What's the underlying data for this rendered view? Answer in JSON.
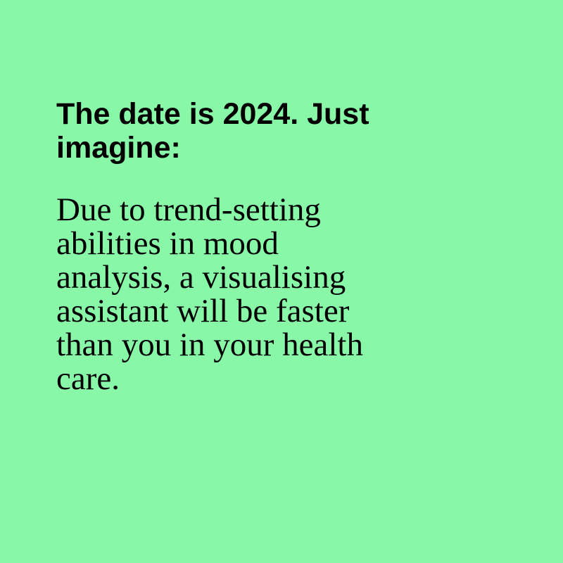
{
  "background_color": "#88f8a8",
  "text_color": "#000000",
  "headline": {
    "lines": [
      "The date is 2024. Just",
      "imagine:"
    ]
  },
  "body": {
    "lines": [
      "Due to trend-setting",
      "abilities in mood",
      "analysis, a visualising",
      "assistant will be faster",
      "than you in your health",
      "care."
    ]
  }
}
